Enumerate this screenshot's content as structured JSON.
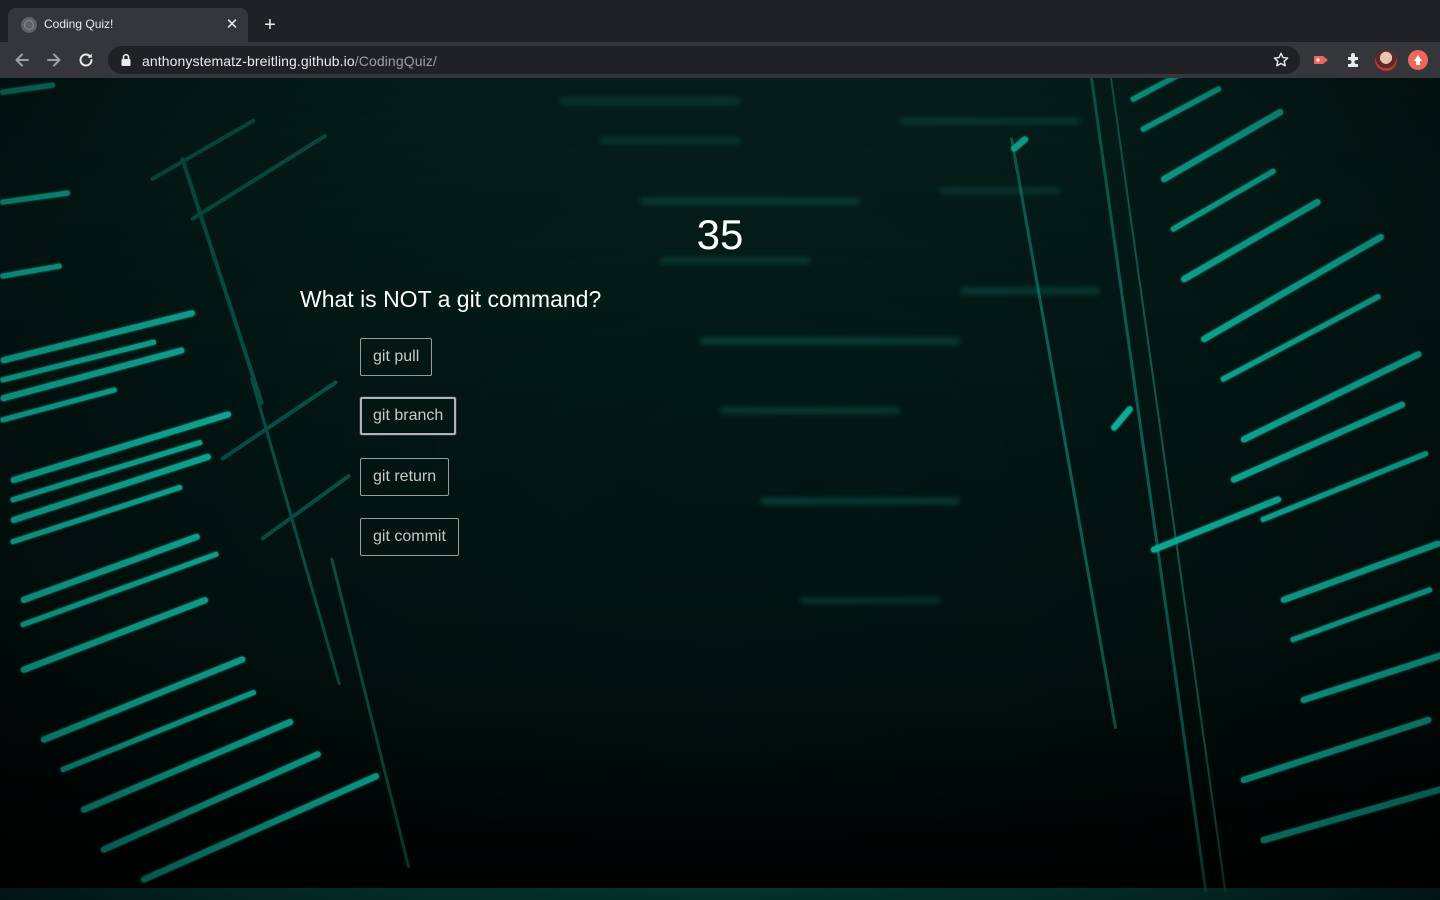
{
  "browser": {
    "tab_title": "Coding Quiz!",
    "url_host": "anthonystematz-breitling.github.io",
    "url_path": "/CodingQuiz/",
    "icons": {
      "tab_close": "close-icon",
      "new_tab": "plus-icon",
      "back": "arrow-left-icon",
      "forward": "arrow-right-icon",
      "reload": "reload-icon",
      "secure": "lock-icon",
      "bookmark": "star-icon",
      "extension_1": "tag-extension-icon",
      "extensions": "puzzle-icon",
      "profile": "avatar",
      "update": "update-arrow-icon"
    }
  },
  "quiz": {
    "timer": "35",
    "question": "What is NOT a git command?",
    "answers": [
      {
        "label": "git pull"
      },
      {
        "label": "git branch"
      },
      {
        "label": "git return"
      },
      {
        "label": "git commit"
      }
    ]
  },
  "colors": {
    "chrome_dark": "#202124",
    "chrome_toolbar": "#35363a",
    "page_bg": "#01110f",
    "code_glow": "#19e6c8",
    "text": "#ffffff",
    "button_text": "#c8c8c8"
  }
}
